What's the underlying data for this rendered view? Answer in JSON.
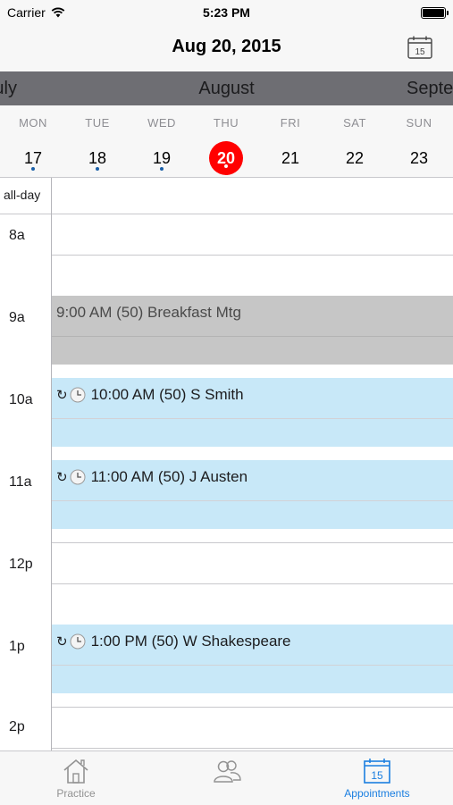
{
  "status_bar": {
    "carrier": "Carrier",
    "time": "5:23 PM"
  },
  "nav": {
    "title": "Aug 20, 2015",
    "calendar_icon_day": "15"
  },
  "months": {
    "prev": "July",
    "current": "August",
    "next": "September"
  },
  "week": [
    {
      "name": "MON",
      "num": "17",
      "has_event": true,
      "selected": false
    },
    {
      "name": "TUE",
      "num": "18",
      "has_event": true,
      "selected": false
    },
    {
      "name": "WED",
      "num": "19",
      "has_event": true,
      "selected": false
    },
    {
      "name": "THU",
      "num": "20",
      "has_event": true,
      "selected": true
    },
    {
      "name": "FRI",
      "num": "21",
      "has_event": false,
      "selected": false
    },
    {
      "name": "SAT",
      "num": "22",
      "has_event": false,
      "selected": false
    },
    {
      "name": "SUN",
      "num": "23",
      "has_event": false,
      "selected": false
    }
  ],
  "grid": {
    "allday_label": "all-day",
    "hours": [
      "8a",
      "9a",
      "10a",
      "11a",
      "12p",
      "1p",
      "2p"
    ]
  },
  "events": [
    {
      "text": "9:00 AM (50) Breakfast Mtg",
      "style": "gray",
      "recurring": false
    },
    {
      "text": "10:00 AM (50) S Smith",
      "style": "blue",
      "recurring": true
    },
    {
      "text": "11:00 AM (50) J Austen",
      "style": "blue",
      "recurring": true
    },
    {
      "text": "1:00 PM (50) W Shakespeare",
      "style": "blue",
      "recurring": true
    }
  ],
  "tabs": [
    {
      "label": "Practice",
      "icon": "house-icon",
      "active": false
    },
    {
      "label": "",
      "icon": "people-icon",
      "active": false
    },
    {
      "label": "Appointments",
      "icon": "calendar-icon",
      "active": true,
      "icon_day": "15"
    }
  ],
  "colors": {
    "accent": "#1a7ee0",
    "selected_day": "#ff0000",
    "event_blue": "#c8e8f8",
    "event_gray": "#c6c6c6"
  }
}
